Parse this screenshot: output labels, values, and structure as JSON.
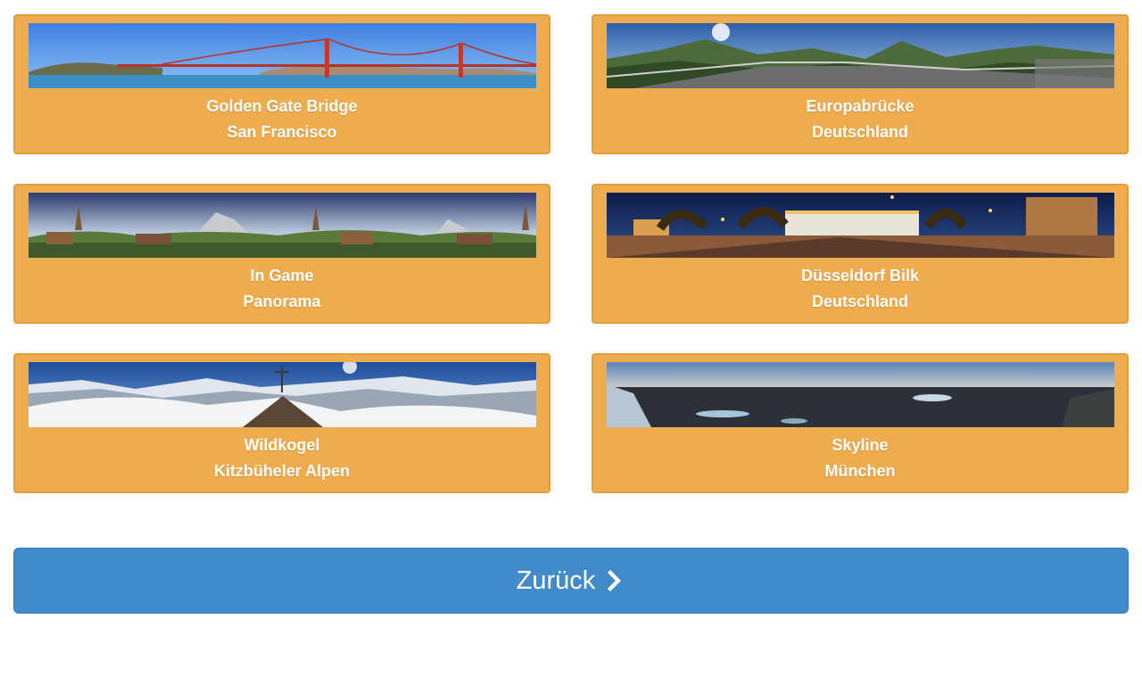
{
  "colors": {
    "card_bg": "#efac4e",
    "card_border": "#e39e3a",
    "button_bg": "#428bca",
    "text": "#ffffff"
  },
  "panoramas": [
    {
      "title": "Golden Gate Bridge",
      "subtitle": "San Francisco"
    },
    {
      "title": "Europabrücke",
      "subtitle": "Deutschland"
    },
    {
      "title": "In Game",
      "subtitle": "Panorama"
    },
    {
      "title": "Düsseldorf Bilk",
      "subtitle": "Deutschland"
    },
    {
      "title": "Wildkogel",
      "subtitle": "Kitzbüheler Alpen"
    },
    {
      "title": "Skyline",
      "subtitle": "München"
    }
  ],
  "back_button": {
    "label": "Zurück",
    "icon": "chevron-right-icon"
  }
}
